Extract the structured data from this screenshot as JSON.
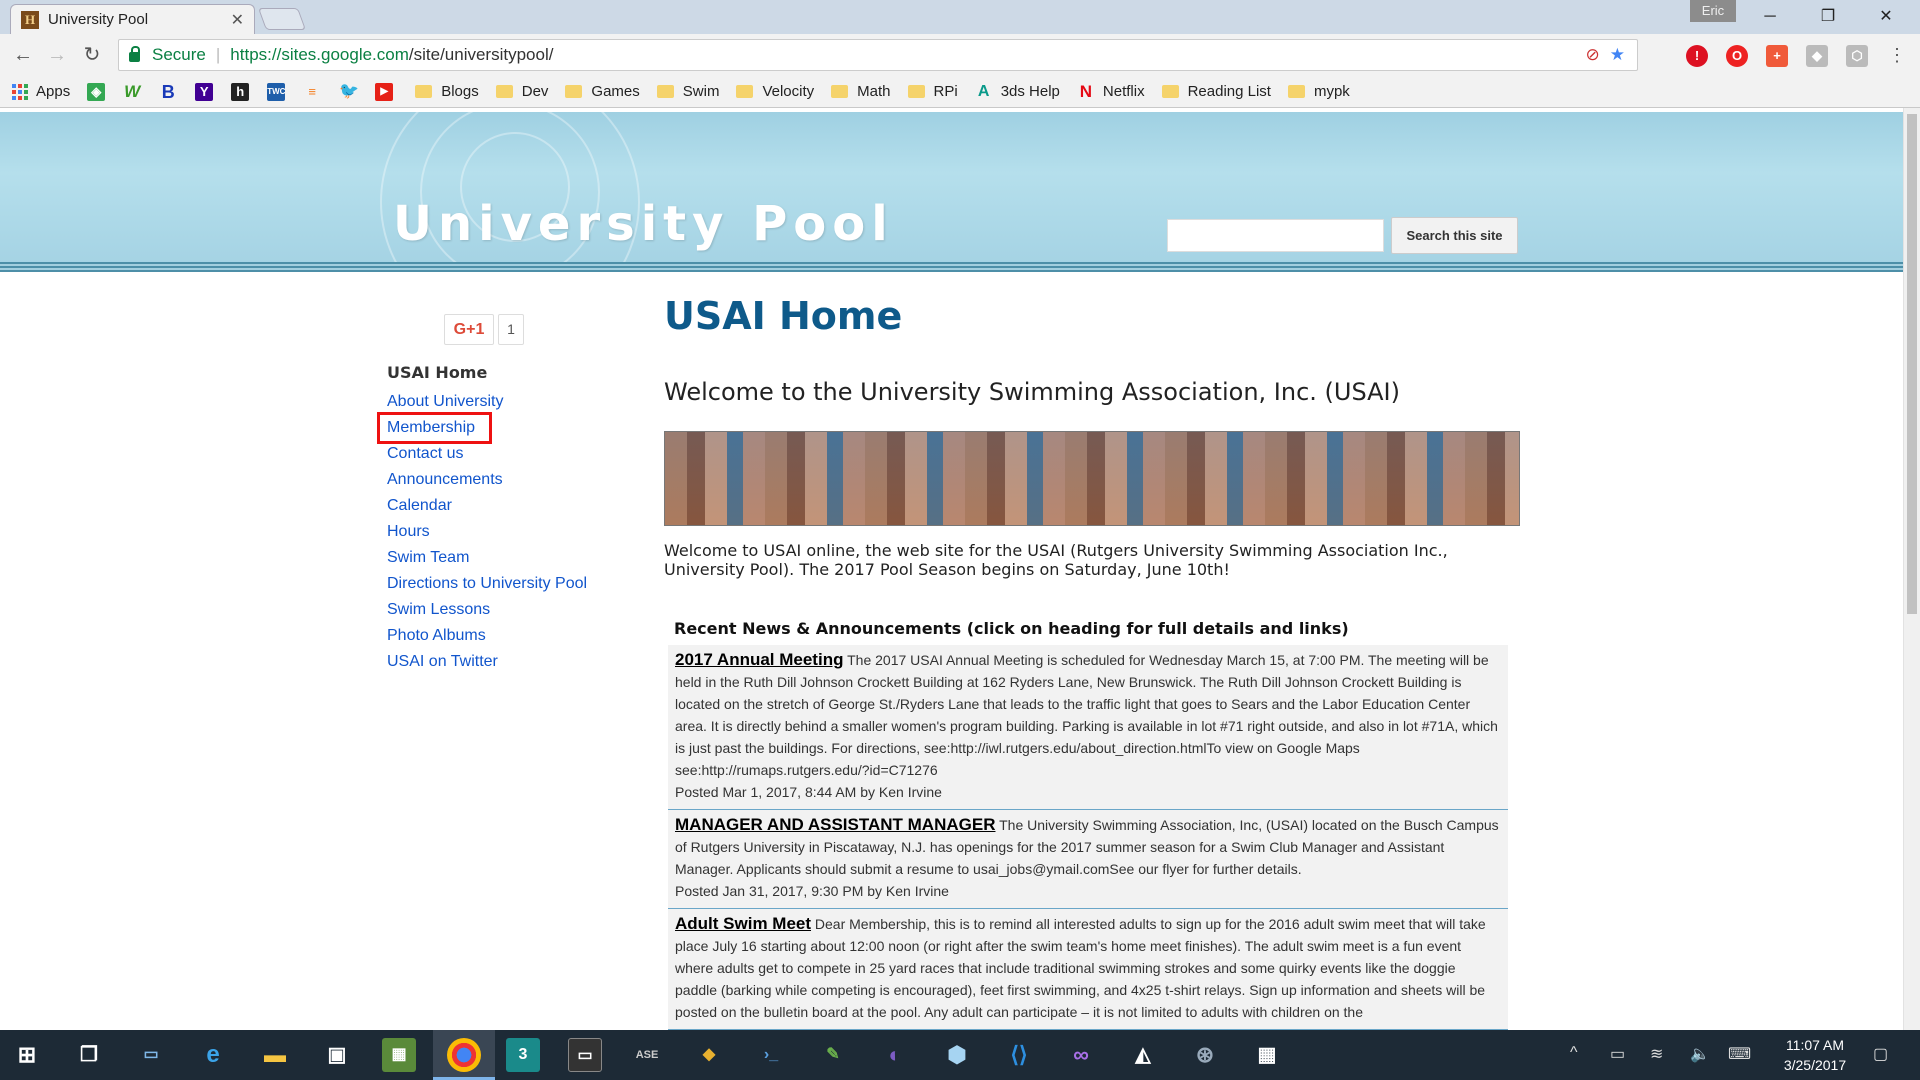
{
  "browser": {
    "tab_title": "University Pool",
    "tab_favicon": "H",
    "tab_close": "✕",
    "user_name": "Eric",
    "secure_label": "Secure",
    "url_host": "https://sites.google.com",
    "url_path": "/site/universitypool/",
    "bookmarks": {
      "apps": "Apps",
      "blogs": "Blogs",
      "dev": "Dev",
      "games": "Games",
      "swim": "Swim",
      "velocity": "Velocity",
      "math": "Math",
      "rpi": "RPi",
      "help3ds": "3ds Help",
      "netflix": "Netflix",
      "reading": "Reading List",
      "mypk": "mypk"
    }
  },
  "site": {
    "title": "University Pool",
    "search_button": "Search this site",
    "plusone_label": "G+1",
    "plusone_count": "1"
  },
  "sidebar": {
    "items": [
      "USAI Home",
      "About University",
      "Membership",
      "Contact us",
      "Announcements",
      "Calendar",
      "Hours",
      "Swim Team",
      "Directions to University Pool",
      "Swim Lessons",
      "Photo Albums",
      "USAI on Twitter"
    ]
  },
  "main": {
    "page_title": "USAI Home",
    "welcome_heading": "Welcome to the University Swimming Association, Inc. (USAI)",
    "intro": "Welcome to USAI online, the web site for the USAI (Rutgers University Swimming Association Inc., University Pool). The 2017 Pool Season begins on Saturday, June 10th!",
    "news_heading": "Recent News & Announcements (click on heading for full details and links)",
    "news": [
      {
        "heading": "2017 Annual Meeting",
        "body": "The 2017 USAI Annual Meeting is scheduled for Wednesday March 15, at 7:00 PM.  The meeting will be held in the Ruth Dill Johnson Crockett Building at 162 Ryders Lane, New Brunswick.  The Ruth Dill Johnson Crockett Building is located on the stretch of George St./Ryders Lane that leads to the traffic light that goes to Sears and the Labor Education Center area. It is directly behind a smaller women's program building. Parking is available in lot #71 right outside, and also in lot #71A, which is just past the buildings. For directions, see:http://iwl.rutgers.edu/about_direction.htmlTo view on Google Maps see:http://rumaps.rutgers.edu/?id=C71276",
        "posted": "Posted Mar 1, 2017, 8:44 AM by Ken Irvine"
      },
      {
        "heading": "MANAGER AND ASSISTANT MANAGER",
        "body": "The University Swimming Association, Inc, (USAI) located on the Busch Campus of Rutgers University in Piscataway, N.J. has openings for the 2017 summer season for a Swim Club Manager and Assistant Manager.  Applicants should submit a resume to usai_jobs@ymail.comSee our flyer for further details.",
        "posted": "Posted Jan 31, 2017, 9:30 PM by Ken Irvine"
      },
      {
        "heading": "Adult Swim Meet",
        "body": "Dear Membership, this is to remind all interested adults to sign up for the 2016 adult swim meet that will take place July 16 starting about 12:00 noon (or right after the swim team's home meet finishes).  The adult swim meet is a fun event where adults get to compete in 25 yard races that include traditional swimming strokes and some quirky events like the doggie paddle (barking while competing is encouraged), feet first swimming, and 4x25 t-shirt relays.  Sign up information and sheets will be posted on the bulletin board at the pool.  Any adult can participate – it is not limited to adults with children on the",
        "posted": ""
      }
    ]
  },
  "taskbar": {
    "time": "11:07 AM",
    "date": "3/25/2017"
  }
}
